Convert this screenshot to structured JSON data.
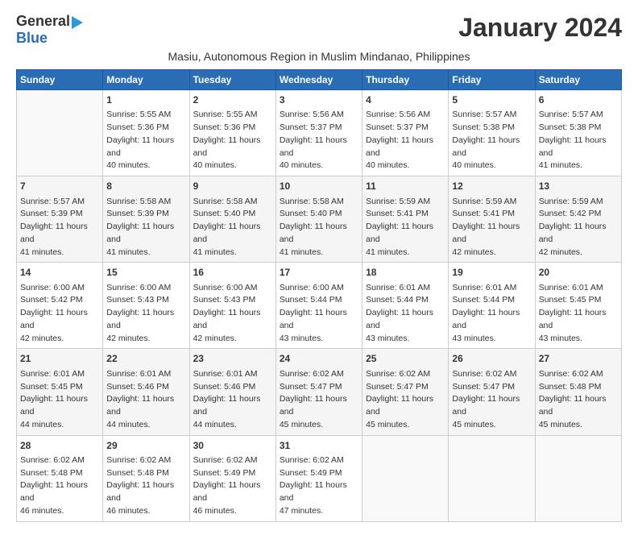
{
  "header": {
    "logo_general": "General",
    "logo_blue": "Blue",
    "month_title": "January 2024",
    "subtitle": "Masiu, Autonomous Region in Muslim Mindanao, Philippines"
  },
  "weekdays": [
    "Sunday",
    "Monday",
    "Tuesday",
    "Wednesday",
    "Thursday",
    "Friday",
    "Saturday"
  ],
  "weeks": [
    [
      {
        "day": "",
        "sunrise": "",
        "sunset": "",
        "daylight": ""
      },
      {
        "day": "1",
        "sunrise": "Sunrise: 5:55 AM",
        "sunset": "Sunset: 5:36 PM",
        "daylight": "Daylight: 11 hours and 40 minutes."
      },
      {
        "day": "2",
        "sunrise": "Sunrise: 5:55 AM",
        "sunset": "Sunset: 5:36 PM",
        "daylight": "Daylight: 11 hours and 40 minutes."
      },
      {
        "day": "3",
        "sunrise": "Sunrise: 5:56 AM",
        "sunset": "Sunset: 5:37 PM",
        "daylight": "Daylight: 11 hours and 40 minutes."
      },
      {
        "day": "4",
        "sunrise": "Sunrise: 5:56 AM",
        "sunset": "Sunset: 5:37 PM",
        "daylight": "Daylight: 11 hours and 40 minutes."
      },
      {
        "day": "5",
        "sunrise": "Sunrise: 5:57 AM",
        "sunset": "Sunset: 5:38 PM",
        "daylight": "Daylight: 11 hours and 40 minutes."
      },
      {
        "day": "6",
        "sunrise": "Sunrise: 5:57 AM",
        "sunset": "Sunset: 5:38 PM",
        "daylight": "Daylight: 11 hours and 41 minutes."
      }
    ],
    [
      {
        "day": "7",
        "sunrise": "Sunrise: 5:57 AM",
        "sunset": "Sunset: 5:39 PM",
        "daylight": "Daylight: 11 hours and 41 minutes."
      },
      {
        "day": "8",
        "sunrise": "Sunrise: 5:58 AM",
        "sunset": "Sunset: 5:39 PM",
        "daylight": "Daylight: 11 hours and 41 minutes."
      },
      {
        "day": "9",
        "sunrise": "Sunrise: 5:58 AM",
        "sunset": "Sunset: 5:40 PM",
        "daylight": "Daylight: 11 hours and 41 minutes."
      },
      {
        "day": "10",
        "sunrise": "Sunrise: 5:58 AM",
        "sunset": "Sunset: 5:40 PM",
        "daylight": "Daylight: 11 hours and 41 minutes."
      },
      {
        "day": "11",
        "sunrise": "Sunrise: 5:59 AM",
        "sunset": "Sunset: 5:41 PM",
        "daylight": "Daylight: 11 hours and 41 minutes."
      },
      {
        "day": "12",
        "sunrise": "Sunrise: 5:59 AM",
        "sunset": "Sunset: 5:41 PM",
        "daylight": "Daylight: 11 hours and 42 minutes."
      },
      {
        "day": "13",
        "sunrise": "Sunrise: 5:59 AM",
        "sunset": "Sunset: 5:42 PM",
        "daylight": "Daylight: 11 hours and 42 minutes."
      }
    ],
    [
      {
        "day": "14",
        "sunrise": "Sunrise: 6:00 AM",
        "sunset": "Sunset: 5:42 PM",
        "daylight": "Daylight: 11 hours and 42 minutes."
      },
      {
        "day": "15",
        "sunrise": "Sunrise: 6:00 AM",
        "sunset": "Sunset: 5:43 PM",
        "daylight": "Daylight: 11 hours and 42 minutes."
      },
      {
        "day": "16",
        "sunrise": "Sunrise: 6:00 AM",
        "sunset": "Sunset: 5:43 PM",
        "daylight": "Daylight: 11 hours and 42 minutes."
      },
      {
        "day": "17",
        "sunrise": "Sunrise: 6:00 AM",
        "sunset": "Sunset: 5:44 PM",
        "daylight": "Daylight: 11 hours and 43 minutes."
      },
      {
        "day": "18",
        "sunrise": "Sunrise: 6:01 AM",
        "sunset": "Sunset: 5:44 PM",
        "daylight": "Daylight: 11 hours and 43 minutes."
      },
      {
        "day": "19",
        "sunrise": "Sunrise: 6:01 AM",
        "sunset": "Sunset: 5:44 PM",
        "daylight": "Daylight: 11 hours and 43 minutes."
      },
      {
        "day": "20",
        "sunrise": "Sunrise: 6:01 AM",
        "sunset": "Sunset: 5:45 PM",
        "daylight": "Daylight: 11 hours and 43 minutes."
      }
    ],
    [
      {
        "day": "21",
        "sunrise": "Sunrise: 6:01 AM",
        "sunset": "Sunset: 5:45 PM",
        "daylight": "Daylight: 11 hours and 44 minutes."
      },
      {
        "day": "22",
        "sunrise": "Sunrise: 6:01 AM",
        "sunset": "Sunset: 5:46 PM",
        "daylight": "Daylight: 11 hours and 44 minutes."
      },
      {
        "day": "23",
        "sunrise": "Sunrise: 6:01 AM",
        "sunset": "Sunset: 5:46 PM",
        "daylight": "Daylight: 11 hours and 44 minutes."
      },
      {
        "day": "24",
        "sunrise": "Sunrise: 6:02 AM",
        "sunset": "Sunset: 5:47 PM",
        "daylight": "Daylight: 11 hours and 45 minutes."
      },
      {
        "day": "25",
        "sunrise": "Sunrise: 6:02 AM",
        "sunset": "Sunset: 5:47 PM",
        "daylight": "Daylight: 11 hours and 45 minutes."
      },
      {
        "day": "26",
        "sunrise": "Sunrise: 6:02 AM",
        "sunset": "Sunset: 5:47 PM",
        "daylight": "Daylight: 11 hours and 45 minutes."
      },
      {
        "day": "27",
        "sunrise": "Sunrise: 6:02 AM",
        "sunset": "Sunset: 5:48 PM",
        "daylight": "Daylight: 11 hours and 45 minutes."
      }
    ],
    [
      {
        "day": "28",
        "sunrise": "Sunrise: 6:02 AM",
        "sunset": "Sunset: 5:48 PM",
        "daylight": "Daylight: 11 hours and 46 minutes."
      },
      {
        "day": "29",
        "sunrise": "Sunrise: 6:02 AM",
        "sunset": "Sunset: 5:48 PM",
        "daylight": "Daylight: 11 hours and 46 minutes."
      },
      {
        "day": "30",
        "sunrise": "Sunrise: 6:02 AM",
        "sunset": "Sunset: 5:49 PM",
        "daylight": "Daylight: 11 hours and 46 minutes."
      },
      {
        "day": "31",
        "sunrise": "Sunrise: 6:02 AM",
        "sunset": "Sunset: 5:49 PM",
        "daylight": "Daylight: 11 hours and 47 minutes."
      },
      {
        "day": "",
        "sunrise": "",
        "sunset": "",
        "daylight": ""
      },
      {
        "day": "",
        "sunrise": "",
        "sunset": "",
        "daylight": ""
      },
      {
        "day": "",
        "sunrise": "",
        "sunset": "",
        "daylight": ""
      }
    ]
  ]
}
